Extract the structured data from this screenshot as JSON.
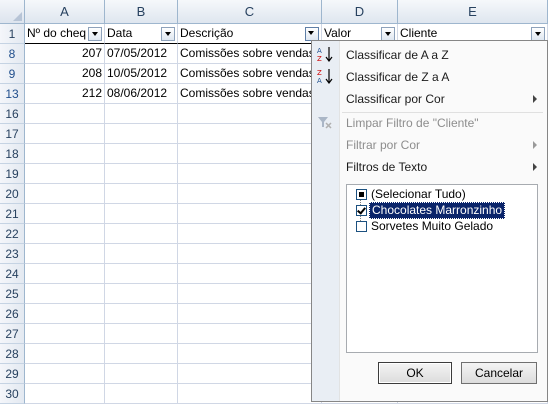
{
  "columns": [
    "A",
    "B",
    "C",
    "D",
    "E"
  ],
  "header_row": {
    "row_number": "1",
    "cells": [
      "Nº do cheq",
      "Data",
      "Descrição",
      "Valor",
      "Cliente"
    ]
  },
  "rows": [
    {
      "row_number": "8",
      "cells": [
        "207",
        "07/05/2012",
        "Comissões sobre vendas"
      ]
    },
    {
      "row_number": "9",
      "cells": [
        "208",
        "10/05/2012",
        "Comissões sobre vendas"
      ]
    },
    {
      "row_number": "13",
      "cells": [
        "212",
        "08/06/2012",
        "Comissões sobre vendas"
      ]
    }
  ],
  "empty_row_numbers": [
    "16",
    "17",
    "18",
    "19",
    "20",
    "21",
    "22",
    "23",
    "24",
    "25",
    "26",
    "27",
    "28",
    "29",
    "30"
  ],
  "menu": {
    "sort_az": "Classificar de A a Z",
    "sort_za": "Classificar de Z a A",
    "sort_color": "Classificar por Cor",
    "clear_filter": "Limpar Filtro de \"Cliente\"",
    "filter_color": "Filtrar por Cor",
    "text_filters": "Filtros de Texto",
    "list": [
      {
        "label": "(Selecionar Tudo)",
        "state": "partial"
      },
      {
        "label": "Chocolates Marronzinho",
        "state": "checked"
      },
      {
        "label": "Sorvetes Muito Gelado",
        "state": "unchecked"
      }
    ],
    "ok": "OK",
    "cancel": "Cancelar"
  },
  "icons": [
    "sort-az-icon",
    "sort-za-icon",
    "clear-filter-icon"
  ]
}
